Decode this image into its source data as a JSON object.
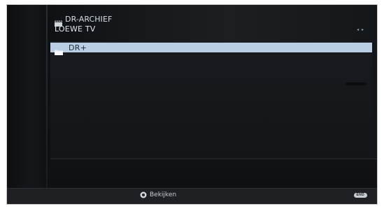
{
  "header": {
    "title": "DR-ARCHIEF",
    "title_icon": "clapperboard-icon",
    "subtitle": "LOEWE TV",
    "nav_arrows": "◂ ▸"
  },
  "list": {
    "items": [
      {
        "label": "DR+",
        "icon": "folder-icon",
        "selected": true
      }
    ]
  },
  "footer": {
    "action_label": "Bekijken",
    "action_icon": "ok-button-icon",
    "end_label": "END"
  },
  "colors": {
    "selection": "#b9cde3",
    "background": "#16191c",
    "text": "#e1e6ec"
  }
}
